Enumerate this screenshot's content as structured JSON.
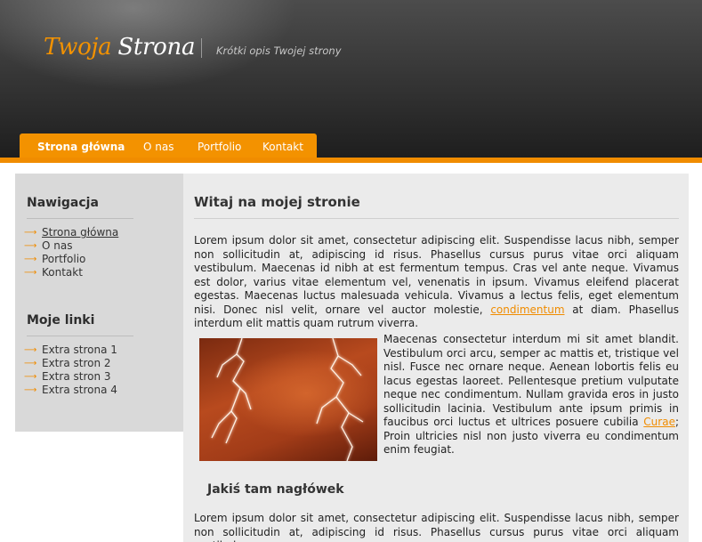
{
  "header": {
    "logo_word1": "Twoja",
    "logo_word2": "Strona",
    "tagline": "Krótki opis Twojej strony"
  },
  "nav": {
    "items": [
      {
        "label": "Strona główna",
        "active": true
      },
      {
        "label": "O nas"
      },
      {
        "label": "Portfolio"
      },
      {
        "label": "Kontakt"
      }
    ]
  },
  "sidebar": {
    "nav_heading": "Nawigacja",
    "nav_items": [
      "Strona główna",
      "O nas",
      "Portfolio",
      "Kontakt"
    ],
    "links_heading": "Moje linki",
    "link_items": [
      "Extra strona 1",
      "Extra stron 2",
      "Extra stron 3",
      "Extra strona 4"
    ]
  },
  "main": {
    "title": "Witaj na mojej stronie",
    "p1_a": "Lorem ipsum dolor sit amet, consectetur adipiscing elit. Suspendisse lacus nibh, semper non sollicitudin at, adipiscing id risus. Phasellus cursus purus vitae orci aliquam vestibulum. Maecenas id nibh at est fermentum tempus. Cras vel ante neque. Vivamus est dolor, varius vitae elementum vel, venenatis in ipsum. Vivamus eleifend placerat egestas. Maecenas luctus malesuada vehicula. Vivamus a lectus felis, eget elementum nisi. Donec nisl velit, ornare vel auctor molestie,",
    "link1": "condimentum",
    "p1_b": "at diam. Phasellus interdum elit mattis quam rutrum viverra.",
    "p1_c": "Maecenas consectetur interdum mi sit amet blandit. Vestibulum orci arcu, semper ac mattis et, tristique vel nisl. Fusce nec ornare neque. Aenean lobortis felis eu lacus egestas laoreet. Pellentesque pretium vulputate neque nec condimentum. Nullam gravida eros in justo sollicitudin lacinia. Vestibulum ante ipsum primis in faucibus orci luctus et ultrices posuere cubilia",
    "link2": "Curae",
    "p1_d": "; Proin ultricies nisl non justo viverra eu condimentum enim feugiat.",
    "subheading": "Jakiś tam nagłówek",
    "p2": "Lorem ipsum dolor sit amet, consectetur adipiscing elit. Suspendisse lacus nibh, semper non sollicitudin at, adipiscing id risus. Phasellus cursus purus vitae orci aliquam vestibulum."
  },
  "colors": {
    "accent": "#f39200",
    "header_dark": "#2a2a2a",
    "sidebar_bg": "#d9d9d9",
    "content_bg": "#ebebeb"
  },
  "icons": {
    "bullet": "arrow-right-icon",
    "image": "lightning-storm-image"
  }
}
